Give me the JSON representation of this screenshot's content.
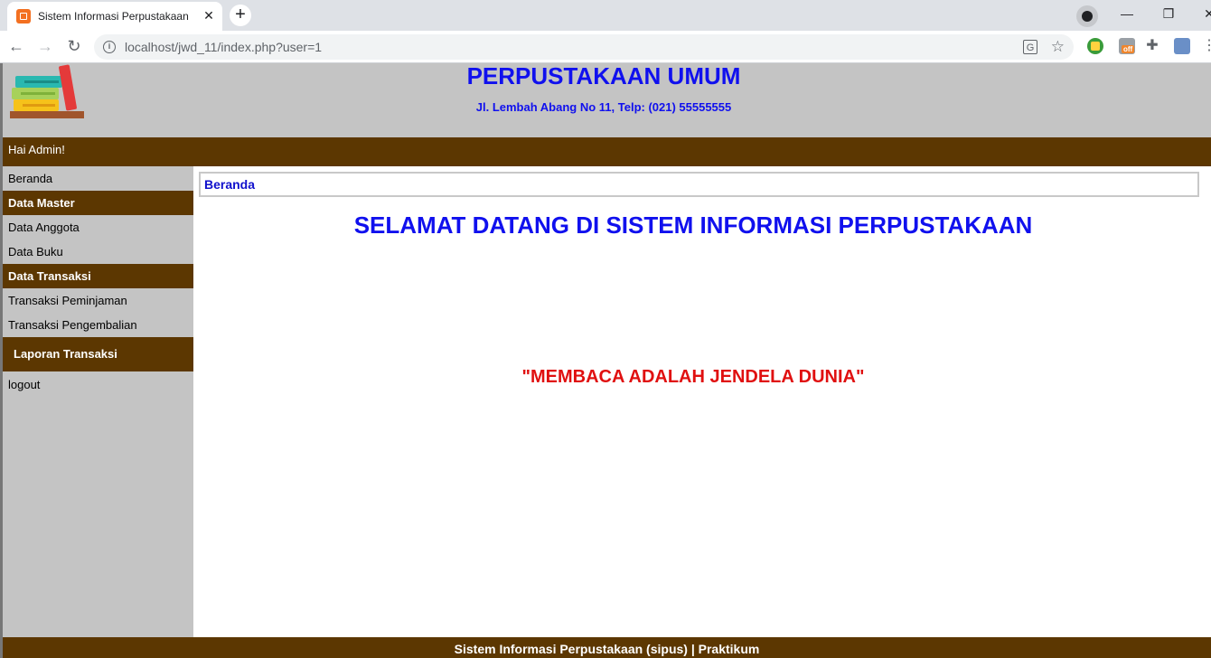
{
  "browser": {
    "tab_title": "Sistem Informasi Perpustakaan",
    "tab_close": "✕",
    "new_tab": "+",
    "url": "localhost/jwd_11/index.php?user=1",
    "info_glyph": "i",
    "translate_glyph": "G",
    "star_glyph": "☆",
    "back_glyph": "←",
    "forward_glyph": "→",
    "reload_glyph": "↻",
    "minimize_glyph": "—",
    "restore_glyph": "❐",
    "close_glyph": "✕",
    "extension_badge": "off",
    "puzzle_glyph": "✚",
    "menu_glyph": "⋮"
  },
  "header": {
    "title": "PERPUSTAKAAN UMUM",
    "address": "Jl. Lembah Abang No 11, Telp: (021) 55555555",
    "greeting": "Hai Admin!"
  },
  "sidebar": {
    "home": "Beranda",
    "master_heading": "Data Master",
    "members": "Data Anggota",
    "books": "Data Buku",
    "transactions_heading": "Data Transaksi",
    "loans": "Transaksi Peminjaman",
    "returns": "Transaksi Pengembalian",
    "report_heading": "Laporan Transaksi",
    "logout": "logout"
  },
  "content": {
    "breadcrumb": "Beranda",
    "welcome": "SELAMAT DATANG DI SISTEM INFORMASI PERPUSTAKAAN",
    "motto": "\"MEMBACA ADALAH JENDELA DUNIA\""
  },
  "footer": {
    "text": "Sistem Informasi Perpustakaan (sipus) | Praktikum"
  },
  "colors": {
    "brown_bar": "#5c3701",
    "gray_panel": "#c4c4c4",
    "title_blue": "#1010ee",
    "motto_red": "#e01010"
  },
  "icons": {
    "logo": "book-stack-logo",
    "favicon": "xampp-favicon"
  }
}
